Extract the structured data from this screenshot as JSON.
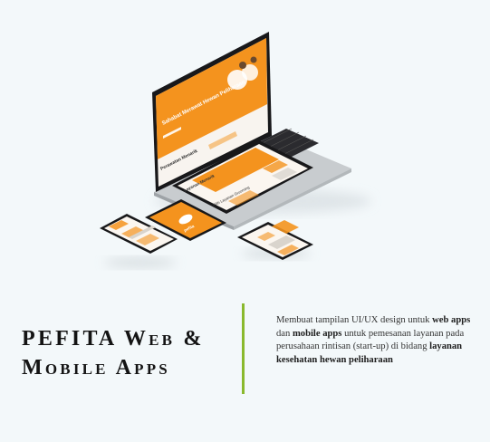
{
  "title": {
    "line1": "PEFITA Web &",
    "line2": "Mobile Apps"
  },
  "description": {
    "t1": "Membuat tampilan UI/UX design untuk ",
    "b1": "web apps",
    "t2": " dan ",
    "b2": "mobile apps",
    "t3": " untuk pemesanan layanan pada perusahaan rintisan (start-up) di bidang ",
    "b3": "layanan kesehatan hewan peliharaan"
  },
  "mockup": {
    "laptop_hero_text": "Sahabat Merawat Hewan Peliharaan",
    "laptop_section_text": "Perawatan Menarik",
    "tablet_heading": "Layanan Menarik",
    "tablet_subheading": "Pilih Layanan Grooming",
    "splash_brand": "pefita"
  },
  "colors": {
    "accent": "#f4931e",
    "divider": "#8ab92d",
    "device": "#1b1b1d",
    "background": "#f3f8fa"
  }
}
